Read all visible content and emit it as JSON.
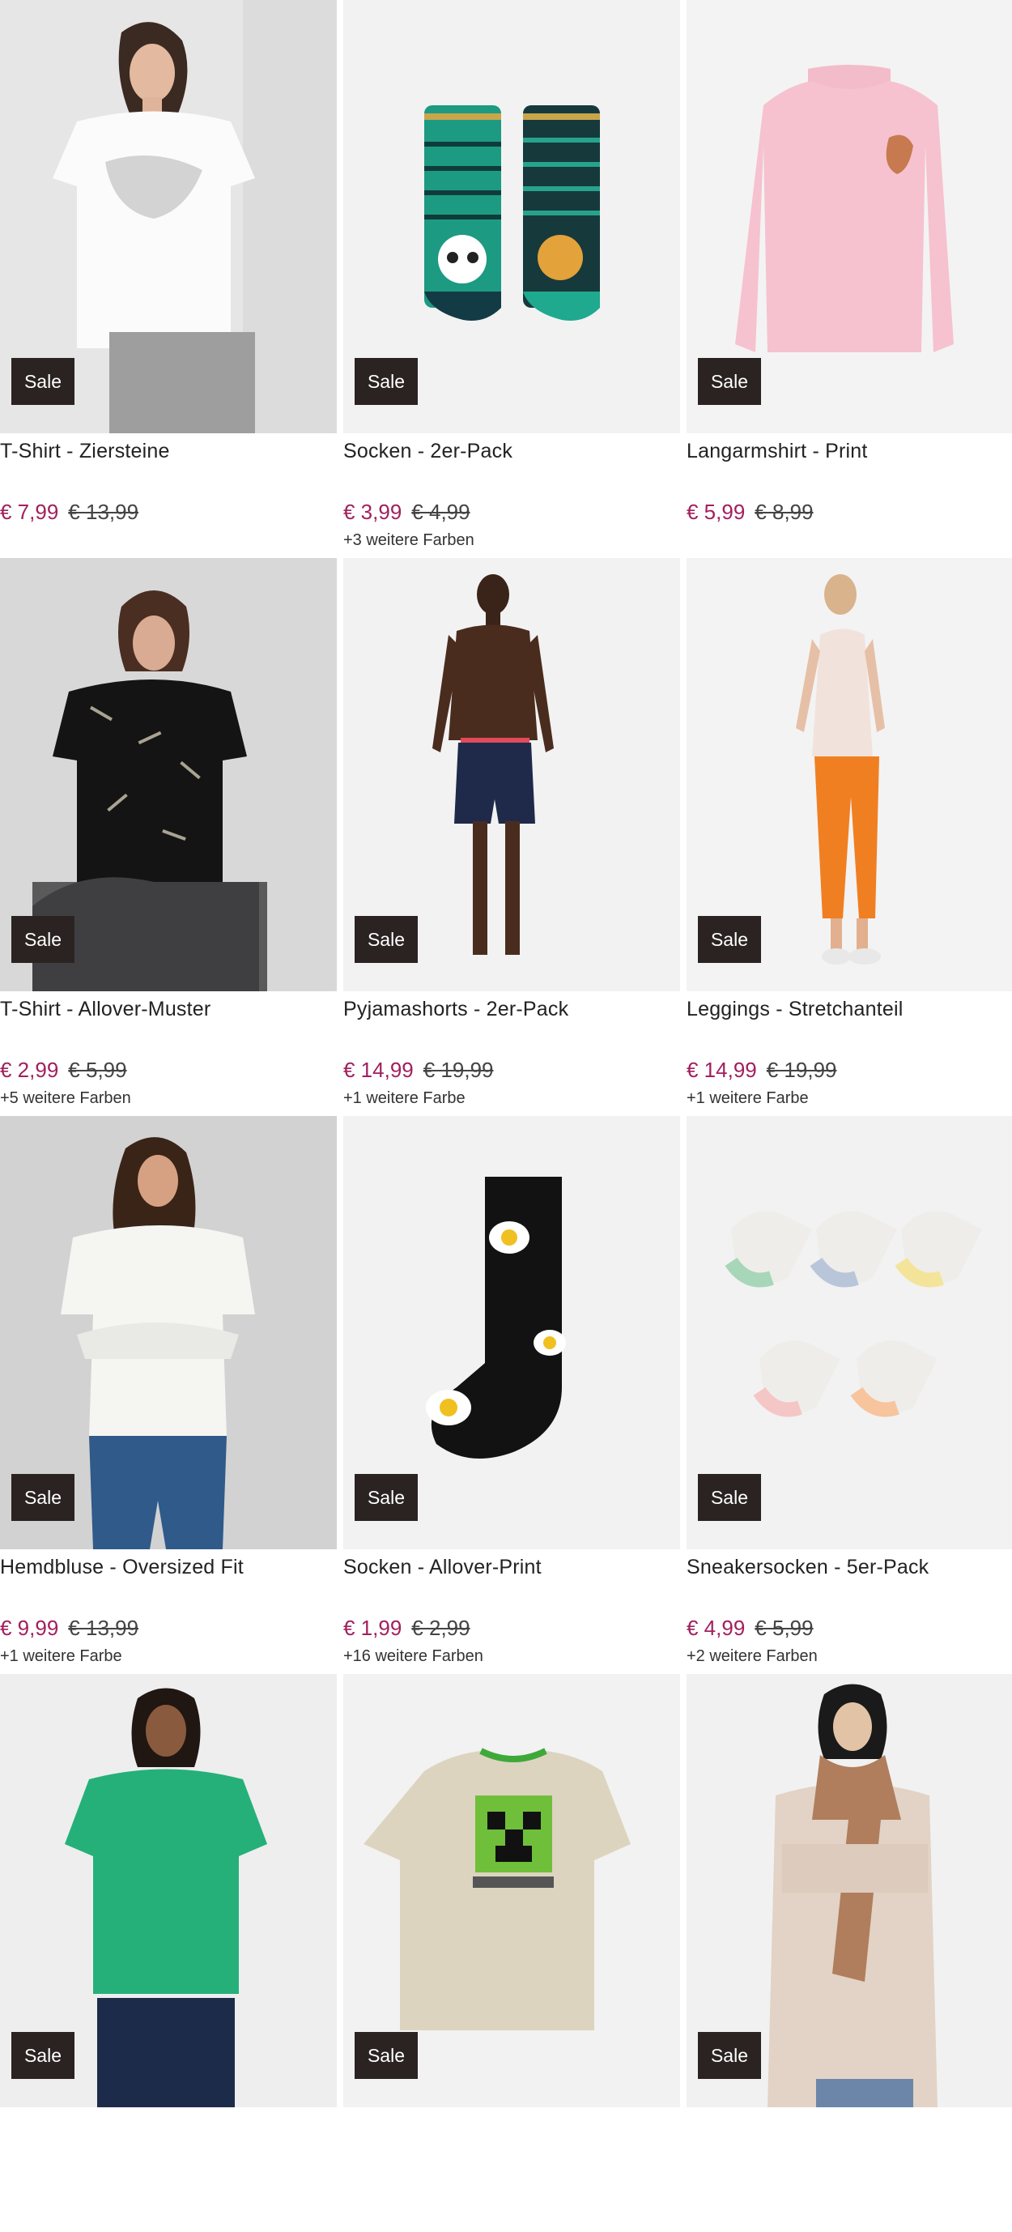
{
  "colors": {
    "price": "#a2205e",
    "badge_bg": "#2a2322",
    "badge_text": "#ffffff"
  },
  "products": [
    {
      "name": "T-Shirt - Ziersteine",
      "price": "€ 7,99",
      "old_price": "€ 13,99",
      "colors": "",
      "badge": "Sale",
      "image": "woman-white-tshirt"
    },
    {
      "name": "Socken - 2er-Pack",
      "price": "€ 3,99",
      "old_price": "€ 4,99",
      "colors": "+3 weitere Farben",
      "badge": "Sale",
      "image": "panda-tiger-socks"
    },
    {
      "name": "Langarmshirt - Print",
      "price": "€ 5,99",
      "old_price": "€ 8,99",
      "colors": "",
      "badge": "Sale",
      "image": "pink-longsleeve"
    },
    {
      "name": "T-Shirt - Allover-Muster",
      "price": "€ 2,99",
      "old_price": "€ 5,99",
      "colors": "+5 weitere Farben",
      "badge": "Sale",
      "image": "woman-black-print-tshirt"
    },
    {
      "name": "Pyjamashorts - 2er-Pack",
      "price": "€ 14,99",
      "old_price": "€ 19,99",
      "colors": "+1 weitere Farbe",
      "badge": "Sale",
      "image": "man-navy-shorts"
    },
    {
      "name": "Leggings - Stretchanteil",
      "price": "€ 14,99",
      "old_price": "€ 19,99",
      "colors": "+1 weitere Farbe",
      "badge": "Sale",
      "image": "woman-orange-leggings"
    },
    {
      "name": "Hemdbluse - Oversized Fit",
      "price": "€ 9,99",
      "old_price": "€ 13,99",
      "colors": "+1 weitere Farbe",
      "badge": "Sale",
      "image": "woman-white-blouse"
    },
    {
      "name": "Socken - Allover-Print",
      "price": "€ 1,99",
      "old_price": "€ 2,99",
      "colors": "+16 weitere Farben",
      "badge": "Sale",
      "image": "egg-print-sock"
    },
    {
      "name": "Sneakersocken - 5er-Pack",
      "price": "€ 4,99",
      "old_price": "€ 5,99",
      "colors": "+2 weitere Farben",
      "badge": "Sale",
      "image": "pastel-sneaker-socks"
    },
    {
      "name": "",
      "price": "",
      "old_price": "",
      "colors": "",
      "badge": "Sale",
      "image": "woman-green-tshirt"
    },
    {
      "name": "",
      "price": "",
      "old_price": "",
      "colors": "",
      "badge": "Sale",
      "image": "minecraft-tshirt"
    },
    {
      "name": "",
      "price": "",
      "old_price": "",
      "colors": "",
      "badge": "Sale",
      "image": "woman-brown-scarf"
    }
  ]
}
